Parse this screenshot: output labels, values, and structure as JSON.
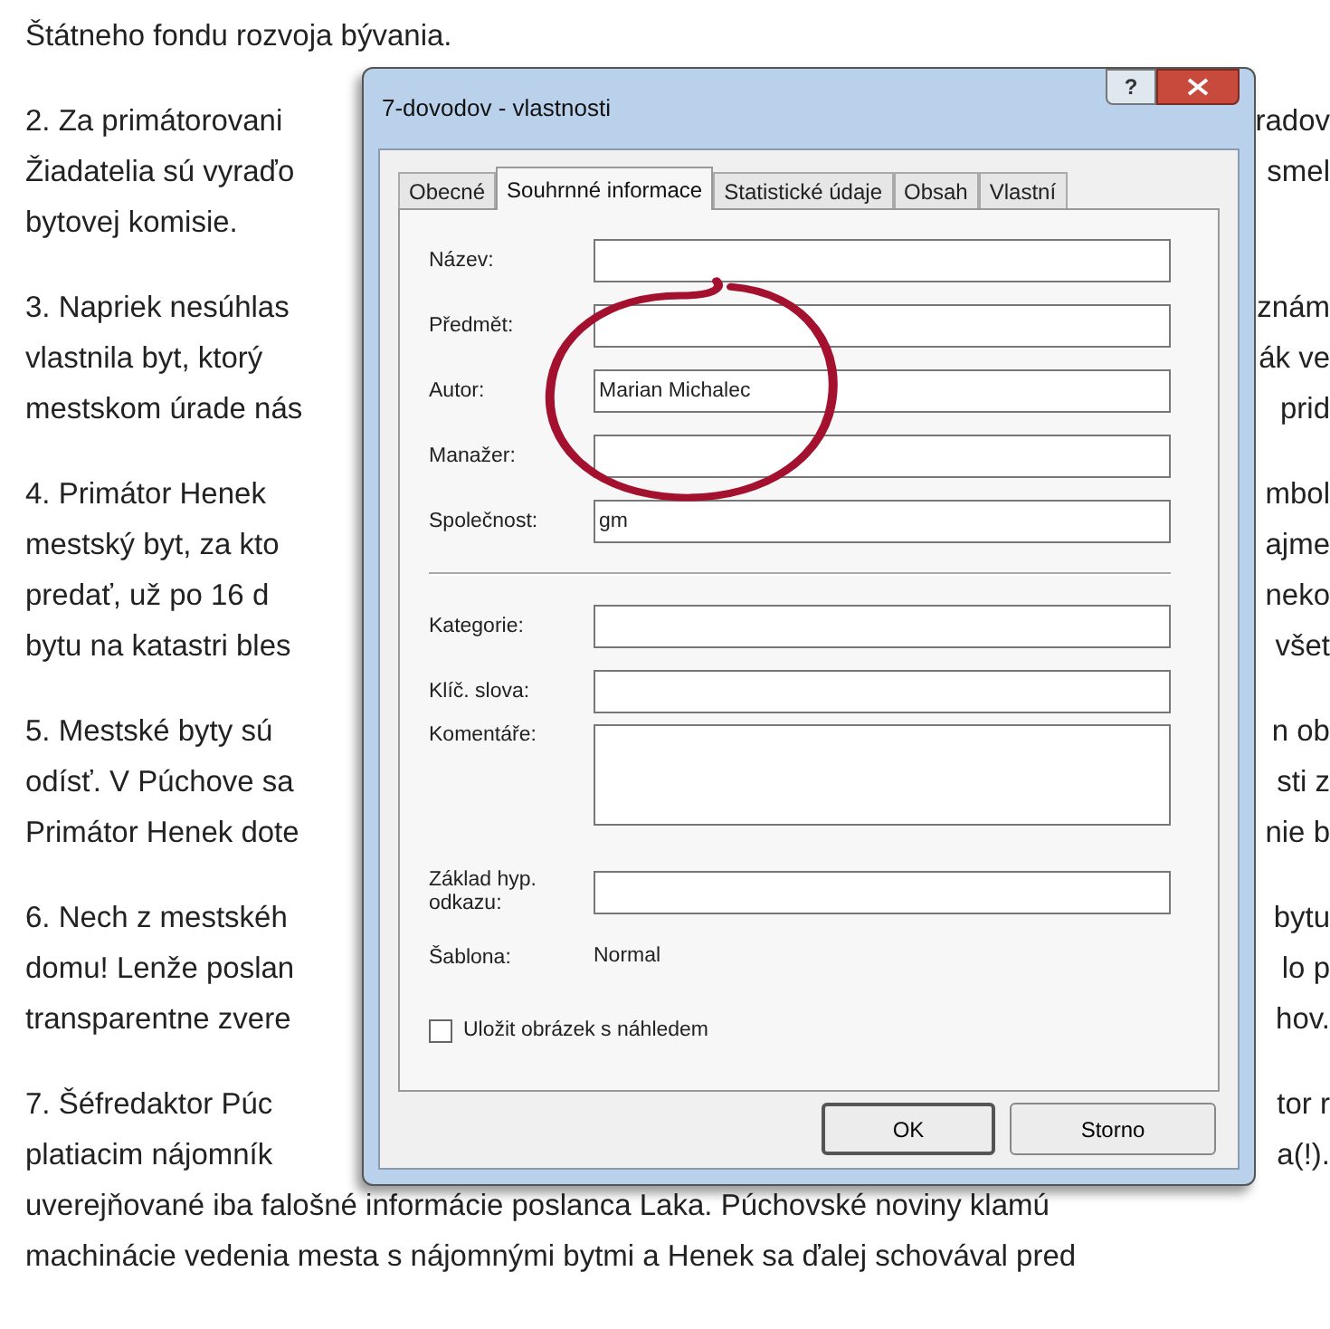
{
  "document": {
    "paragraphs": [
      {
        "lines": [
          {
            "left": "Štátneho fondu rozvoja bývania."
          }
        ]
      },
      {
        "lines": [
          {
            "left": "2. Za primátorovani",
            "right": "radov"
          },
          {
            "left": "Žiadatelia sú vyraďo",
            "right": "smel"
          },
          {
            "left": "bytovej komisie."
          }
        ]
      },
      {
        "lines": [
          {
            "left": "3. Napriek nesúhlas",
            "right": "znám"
          },
          {
            "left": "vlastnila byt, ktorý",
            "right": "ák ve"
          },
          {
            "left": "mestskom úrade nás",
            "right": "prid"
          }
        ]
      },
      {
        "lines": [
          {
            "left": "4. Primátor Henek",
            "right": "mbol"
          },
          {
            "left": "mestský byt, za kto",
            "right": "ajme"
          },
          {
            "left": "predať, už po 16 d",
            "right": "neko"
          },
          {
            "left": "bytu na katastri bles",
            "right": "všet"
          }
        ]
      },
      {
        "lines": [
          {
            "left": "5. Mestské byty sú",
            "right": "n ob"
          },
          {
            "left": "odísť. V Púchove sa",
            "right": "sti z"
          },
          {
            "left": "Primátor Henek dote",
            "right": "nie b"
          }
        ]
      },
      {
        "lines": [
          {
            "left": "6. Nech z mestskéh",
            "right": "bytu"
          },
          {
            "left": "domu! Lenže poslan",
            "right": "lo p"
          },
          {
            "left": "transparentne zvere",
            "right": "hov."
          }
        ]
      },
      {
        "lines": [
          {
            "left": "7. Šéfredaktor Púc",
            "right": "tor r"
          },
          {
            "left": "platiacim nájomník",
            "right": "a(!)."
          },
          {
            "left": "uverejňované iba falošné informácie poslanca Laka. Púchovské noviny klamú"
          },
          {
            "left": "machinácie vedenia mesta s nájomnými bytmi a Henek sa ďalej schovával pred"
          }
        ]
      }
    ]
  },
  "dialog": {
    "title": "7-dovodov - vlastnosti",
    "help": "?",
    "tabs": [
      {
        "label": "Obecné",
        "selected": false
      },
      {
        "label": "Souhrnné informace",
        "selected": true
      },
      {
        "label": "Statistické údaje",
        "selected": false
      },
      {
        "label": "Obsah",
        "selected": false
      },
      {
        "label": "Vlastní",
        "selected": false
      }
    ],
    "fields": [
      {
        "kind": "text",
        "label": "Název:"
      },
      {
        "kind": "text",
        "label": "Předmět:"
      },
      {
        "kind": "text",
        "label": "Autor:",
        "value": "Marian Michalec"
      },
      {
        "kind": "text",
        "label": "Manažer:"
      },
      {
        "kind": "text",
        "label": "Společnost:",
        "value": "gm"
      },
      {
        "kind": "separator"
      },
      {
        "kind": "text",
        "label": "Kategorie:"
      },
      {
        "kind": "text",
        "label": "Klíč. slova:"
      },
      {
        "kind": "multiline",
        "label": "Komentáře:"
      },
      {
        "kind": "text",
        "label": "Základ hyp. odkazu:"
      },
      {
        "kind": "static",
        "label": "Šablona:",
        "value": "Normal"
      }
    ],
    "checkbox": {
      "label": "Uložit obrázek s náhledem",
      "checked": false
    },
    "buttons": [
      "OK",
      "Storno"
    ]
  }
}
